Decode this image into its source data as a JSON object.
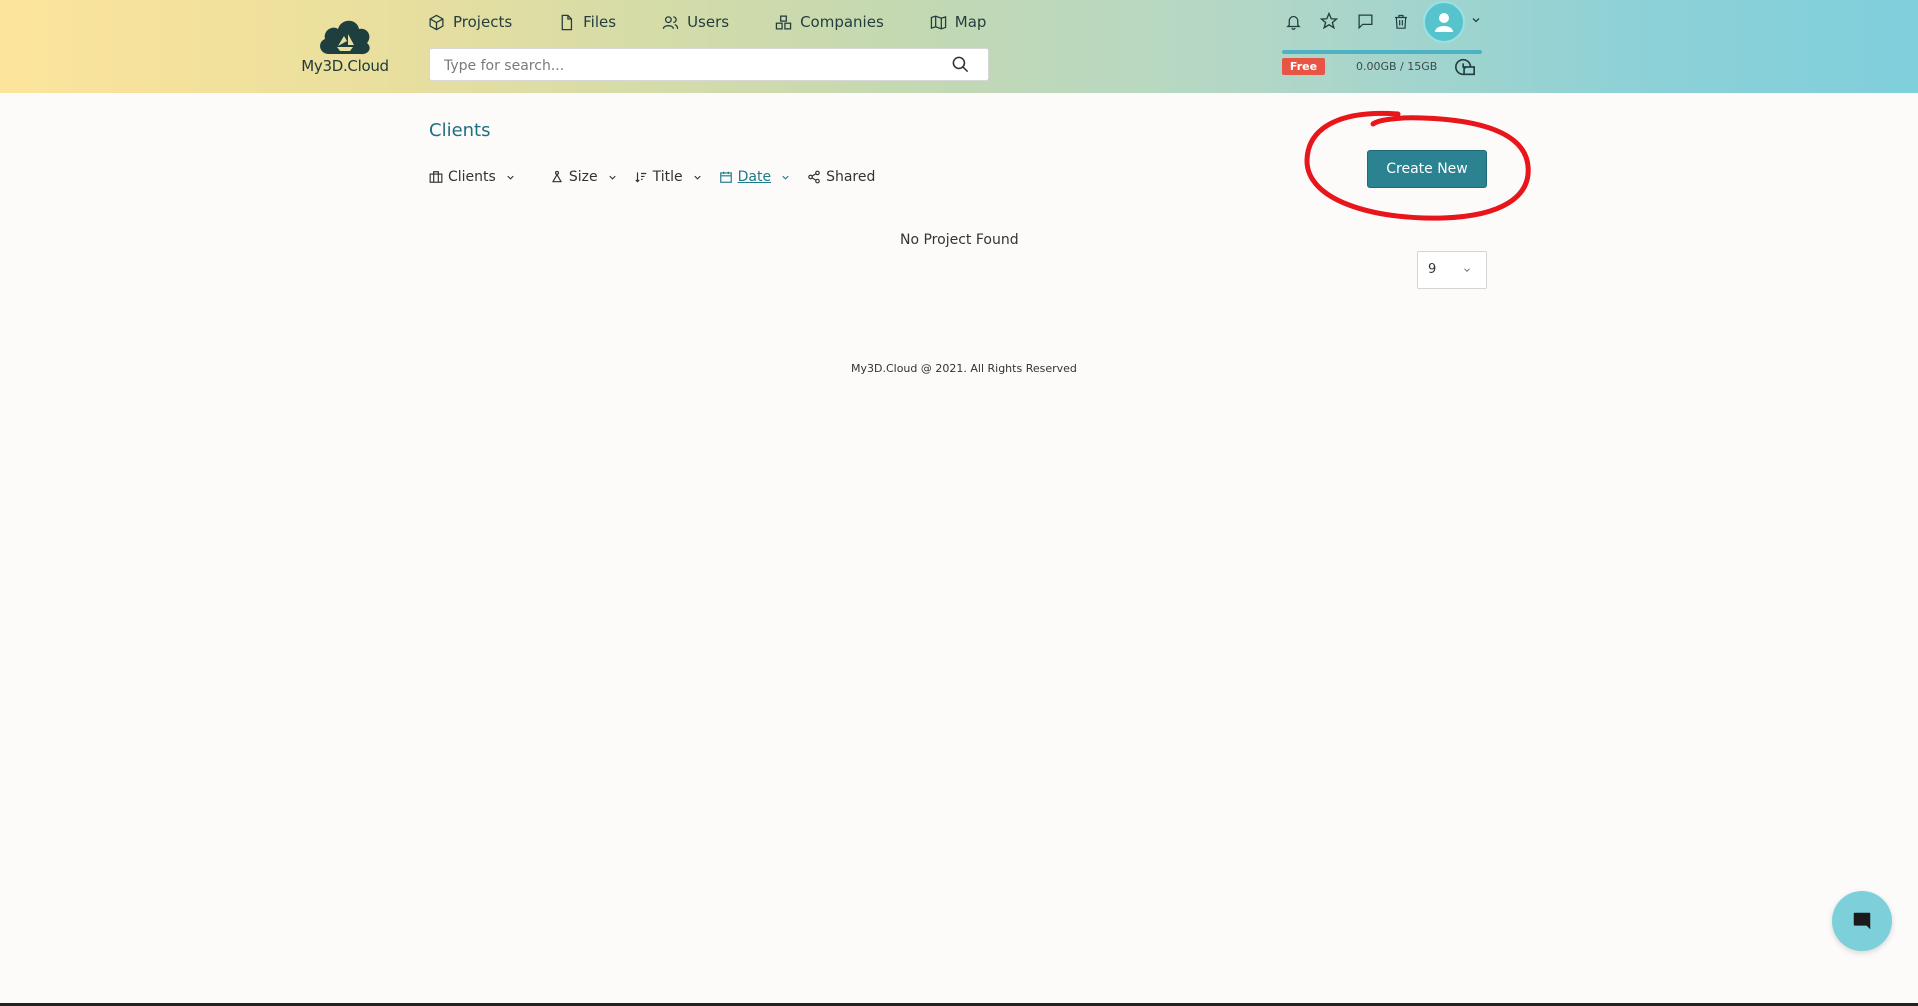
{
  "brand": {
    "name": "My3D.Cloud"
  },
  "nav": {
    "items": [
      {
        "label": "Projects",
        "icon": "cube-icon"
      },
      {
        "label": "Files",
        "icon": "file-icon"
      },
      {
        "label": "Users",
        "icon": "users-icon"
      },
      {
        "label": "Companies",
        "icon": "companies-icon"
      },
      {
        "label": "Map",
        "icon": "map-icon"
      }
    ]
  },
  "search": {
    "placeholder": "Type for search...",
    "value": ""
  },
  "header_icons": [
    "bell-icon",
    "star-icon",
    "chat-bubble-icon",
    "trash-icon"
  ],
  "storage": {
    "plan": "Free",
    "usage_text": "0.00GB / 15GB",
    "used_fraction": 0.0
  },
  "page": {
    "title": "Clients",
    "create_label": "Create New",
    "empty_message": "No Project Found",
    "per_page": "9"
  },
  "toolbar": {
    "clients": "Clients",
    "size": "Size",
    "title": "Title",
    "date": "Date",
    "shared": "Shared",
    "active": "Date"
  },
  "footer": {
    "text": "My3D.Cloud @ 2021. All Rights Reserved"
  },
  "colors": {
    "accent": "#2b8392",
    "title": "#1f6f82",
    "badge": "#e85545",
    "annotation": "#e8151b"
  }
}
